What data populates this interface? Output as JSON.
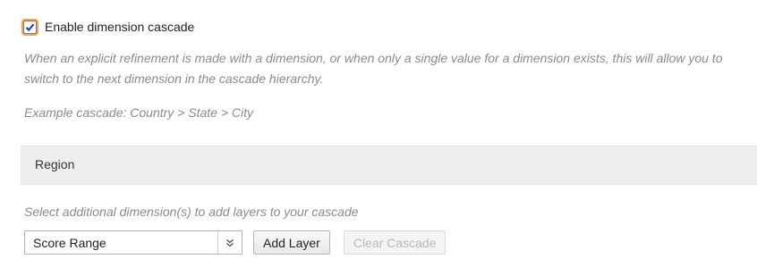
{
  "cascade": {
    "enabled": true,
    "enable_label": "Enable dimension cascade",
    "description": "When an explicit refinement is made with a dimension, or when only a single value for a dimension exists, this will allow you to switch to the next dimension in the cascade hierarchy.",
    "example": "Example cascade: Country > State > City"
  },
  "region": {
    "label": "Region"
  },
  "layers": {
    "hint": "Select additional dimension(s) to add layers to your cascade",
    "selected_dimension": "Score Range",
    "add_label": "Add Layer",
    "clear_label": "Clear Cascade"
  }
}
